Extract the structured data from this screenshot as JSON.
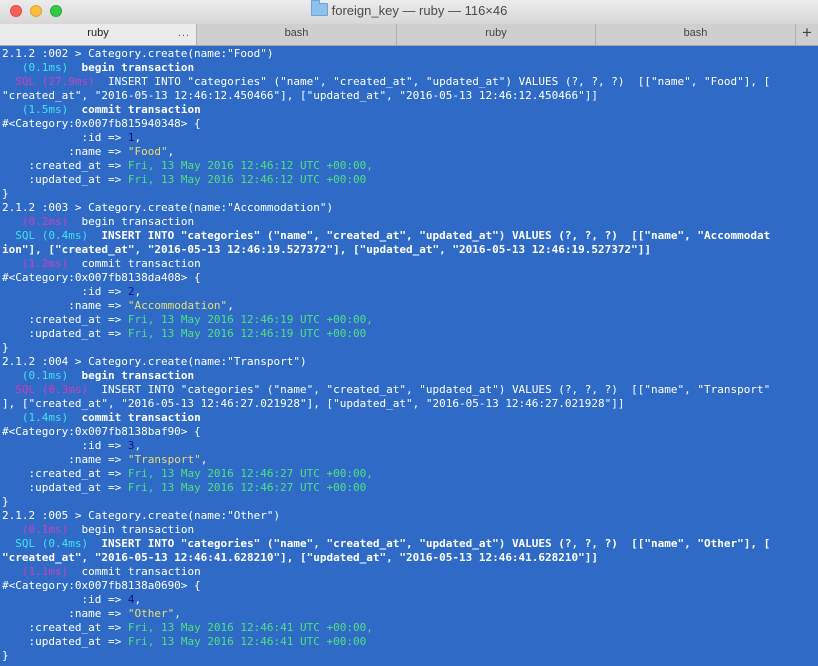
{
  "window": {
    "title": "foreign_key — ruby — 116×46"
  },
  "tabs": [
    {
      "label": "ruby",
      "active": true,
      "more": "..."
    },
    {
      "label": "bash"
    },
    {
      "label": "ruby"
    },
    {
      "label": "bash"
    }
  ],
  "add_tab_label": "+",
  "colors": {
    "background": "#2f6bc6",
    "timing": "#3fe3f0",
    "sql": "#cf3dbd",
    "number": "#10108a",
    "string": "#e8df72",
    "time": "#4fe27e"
  },
  "lines": [
    [
      {
        "t": "2.1.2 :002 > Category.create(name:\"Food\")"
      }
    ],
    [
      {
        "t": "   (0.1ms)",
        "c": "cyan"
      },
      {
        "t": "  begin transaction",
        "c": "b"
      }
    ],
    [
      {
        "t": "  SQL (27.9ms)",
        "c": "mag"
      },
      {
        "t": "  INSERT INTO \"categories\" (\"name\", \"created_at\", \"updated_at\") VALUES (?, ?, ?)  [[\"name\", \"Food\"], ["
      }
    ],
    [
      {
        "t": "\"created_at\", \"2016-05-13 12:46:12.450466\"], [\"updated_at\", \"2016-05-13 12:46:12.450466\"]]"
      }
    ],
    [
      {
        "t": "   (1.5ms)",
        "c": "cyan"
      },
      {
        "t": "  commit transaction",
        "c": "b"
      }
    ],
    [
      {
        "t": "#<Category:0x007fb815940348> {"
      }
    ],
    [
      {
        "t": "            :id => "
      },
      {
        "t": "1",
        "c": "navy"
      },
      {
        "t": ","
      }
    ],
    [
      {
        "t": "          :name => "
      },
      {
        "t": "\"Food\"",
        "c": "yellow"
      },
      {
        "t": ","
      }
    ],
    [
      {
        "t": "    :created_at => "
      },
      {
        "t": "Fri, 13 May 2016 12:46:12 UTC +00:00,",
        "c": "green"
      }
    ],
    [
      {
        "t": "    :updated_at => "
      },
      {
        "t": "Fri, 13 May 2016 12:46:12 UTC +00:00",
        "c": "green"
      }
    ],
    [
      {
        "t": "}"
      }
    ],
    [
      {
        "t": "2.1.2 :003 > Category.create(name:\"Accommodation\")"
      }
    ],
    [
      {
        "t": "   (0.2ms)",
        "c": "mag"
      },
      {
        "t": "  begin transaction"
      }
    ],
    [
      {
        "t": "  SQL (0.4ms)",
        "c": "cyan"
      },
      {
        "t": "  INSERT INTO \"categories\" (\"name\", \"created_at\", \"updated_at\") VALUES (?, ?, ?)  [[\"name\", \"Accommodat",
        "c": "b"
      }
    ],
    [
      {
        "t": "ion\"], [\"created_at\", \"2016-05-13 12:46:19.527372\"], [\"updated_at\", \"2016-05-13 12:46:19.527372\"]]",
        "c": "b"
      }
    ],
    [
      {
        "t": "   (1.2ms)",
        "c": "mag"
      },
      {
        "t": "  commit transaction"
      }
    ],
    [
      {
        "t": "#<Category:0x007fb8138da408> {"
      }
    ],
    [
      {
        "t": "            :id => "
      },
      {
        "t": "2",
        "c": "navy"
      },
      {
        "t": ","
      }
    ],
    [
      {
        "t": "          :name => "
      },
      {
        "t": "\"Accommodation\"",
        "c": "yellow"
      },
      {
        "t": ","
      }
    ],
    [
      {
        "t": "    :created_at => "
      },
      {
        "t": "Fri, 13 May 2016 12:46:19 UTC +00:00,",
        "c": "green"
      }
    ],
    [
      {
        "t": "    :updated_at => "
      },
      {
        "t": "Fri, 13 May 2016 12:46:19 UTC +00:00",
        "c": "green"
      }
    ],
    [
      {
        "t": "}"
      }
    ],
    [
      {
        "t": "2.1.2 :004 > Category.create(name:\"Transport\")"
      }
    ],
    [
      {
        "t": "   (0.1ms)",
        "c": "cyan"
      },
      {
        "t": "  begin transaction",
        "c": "b"
      }
    ],
    [
      {
        "t": "  SQL (0.3ms)",
        "c": "mag"
      },
      {
        "t": "  INSERT INTO \"categories\" (\"name\", \"created_at\", \"updated_at\") VALUES (?, ?, ?)  [[\"name\", \"Transport\""
      }
    ],
    [
      {
        "t": "], [\"created_at\", \"2016-05-13 12:46:27.021928\"], [\"updated_at\", \"2016-05-13 12:46:27.021928\"]]"
      }
    ],
    [
      {
        "t": "   (1.4ms)",
        "c": "cyan"
      },
      {
        "t": "  commit transaction",
        "c": "b"
      }
    ],
    [
      {
        "t": "#<Category:0x007fb8138baf90> {"
      }
    ],
    [
      {
        "t": "            :id => "
      },
      {
        "t": "3",
        "c": "navy"
      },
      {
        "t": ","
      }
    ],
    [
      {
        "t": "          :name => "
      },
      {
        "t": "\"Transport\"",
        "c": "yellow"
      },
      {
        "t": ","
      }
    ],
    [
      {
        "t": "    :created_at => "
      },
      {
        "t": "Fri, 13 May 2016 12:46:27 UTC +00:00,",
        "c": "green"
      }
    ],
    [
      {
        "t": "    :updated_at => "
      },
      {
        "t": "Fri, 13 May 2016 12:46:27 UTC +00:00",
        "c": "green"
      }
    ],
    [
      {
        "t": "}"
      }
    ],
    [
      {
        "t": "2.1.2 :005 > Category.create(name:\"Other\")"
      }
    ],
    [
      {
        "t": "   (0.1ms)",
        "c": "mag"
      },
      {
        "t": "  begin transaction"
      }
    ],
    [
      {
        "t": "  SQL (0.4ms)",
        "c": "cyan"
      },
      {
        "t": "  INSERT INTO \"categories\" (\"name\", \"created_at\", \"updated_at\") VALUES (?, ?, ?)  [[\"name\", \"Other\"], [",
        "c": "b"
      }
    ],
    [
      {
        "t": "\"created_at\", \"2016-05-13 12:46:41.628210\"], [\"updated_at\", \"2016-05-13 12:46:41.628210\"]]",
        "c": "b"
      }
    ],
    [
      {
        "t": "   (1.1ms)",
        "c": "mag"
      },
      {
        "t": "  commit transaction"
      }
    ],
    [
      {
        "t": "#<Category:0x007fb8138a0690> {"
      }
    ],
    [
      {
        "t": "            :id => "
      },
      {
        "t": "4",
        "c": "navy"
      },
      {
        "t": ","
      }
    ],
    [
      {
        "t": "          :name => "
      },
      {
        "t": "\"Other\"",
        "c": "yellow"
      },
      {
        "t": ","
      }
    ],
    [
      {
        "t": "    :created_at => "
      },
      {
        "t": "Fri, 13 May 2016 12:46:41 UTC +00:00,",
        "c": "green"
      }
    ],
    [
      {
        "t": "    :updated_at => "
      },
      {
        "t": "Fri, 13 May 2016 12:46:41 UTC +00:00",
        "c": "green"
      }
    ],
    [
      {
        "t": "}"
      }
    ]
  ]
}
